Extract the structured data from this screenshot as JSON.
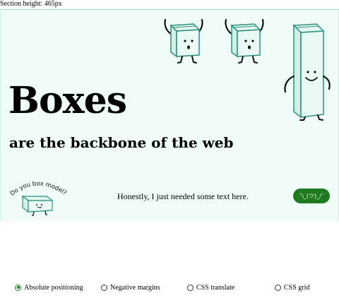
{
  "section_height_label": "Section height: 465px",
  "hero": {
    "title": "Boxes",
    "subtitle": "are the backbone of the web",
    "badge_text": "Do you box model?",
    "body_text": "Honestly, I just needed some text here.",
    "shrug_button": "¯\\_(ツ)_/¯"
  },
  "colors": {
    "hero_background": "#effcf8",
    "box_outline": "#2a8f7e",
    "box_fill": "#e3f7f1",
    "button_background": "#1f7a1f",
    "radio_checked": "#1f7a1f"
  },
  "radio_options": [
    {
      "label": "Absolute positioning",
      "checked": true
    },
    {
      "label": "Negative margins",
      "checked": false
    },
    {
      "label": "CSS translate",
      "checked": false
    },
    {
      "label": "CSS grid",
      "checked": false
    }
  ],
  "icons": {
    "box_character": "box-character-icon",
    "tall_box_character": "tall-box-character-icon",
    "badge_box": "box-model-badge-icon"
  }
}
